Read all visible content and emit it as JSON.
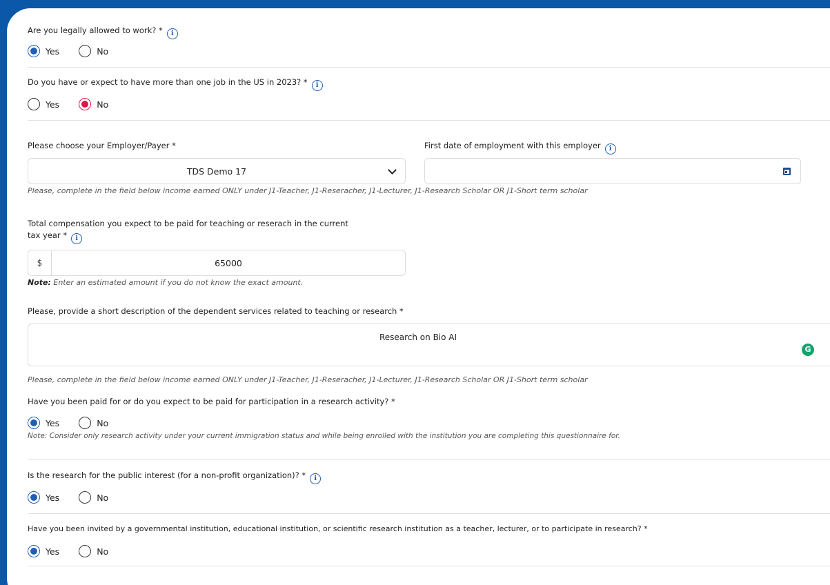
{
  "q1": {
    "label": "Are you legally allowed to work? *",
    "yes": "Yes",
    "no": "No",
    "selected": "Yes"
  },
  "q2": {
    "label": "Do you have or expect to have more than one job in the US in 2023? *",
    "yes": "Yes",
    "no": "No",
    "selected": "No"
  },
  "employer": {
    "label": "Please choose your Employer/Payer *",
    "value": "TDS Demo 17"
  },
  "first_date": {
    "label": "First date of employment with this employer",
    "value": ""
  },
  "hint_income": "Please, complete in the field below income earned ONLY under J1-Teacher, J1-Reseracher, J1-Lecturer, J1-Research Scholar OR J1-Short term scholar",
  "compensation": {
    "label_line1": "Total compensation you expect to be paid for teaching or reserach in the current",
    "label_line2": "tax year *",
    "currency": "$",
    "value": "65000",
    "note_bold": "Note:",
    "note_text": " Enter an estimated amount if you do not know the exact amount."
  },
  "description": {
    "label": "Please, provide a short description of the dependent services related to teaching or research *",
    "value": "Research on Bio AI",
    "grammarly": "G"
  },
  "hint_income_2": "Please, complete in the field below income earned ONLY under J1-Teacher, J1-Reseracher, J1-Lecturer, J1-Research Scholar OR J1-Short term scholar",
  "q3": {
    "label": "Have you been paid for or do you expect to be paid for participation in a research activity? *",
    "yes": "Yes",
    "no": "No",
    "selected": "Yes",
    "note": "Note: Consider only research activity under your current immigration status and while being enrolled with the institution you are completing this questionnaire for."
  },
  "q4": {
    "label": "Is the research for the public interest (for a non-profit organization)? *",
    "yes": "Yes",
    "no": "No",
    "selected": "Yes"
  },
  "q5": {
    "label": "Have you been invited by a governmental institution, educational institution, or scientific research institution as a teacher, lecturer, or to participate in research? *",
    "yes": "Yes",
    "no": "No",
    "selected": "Yes"
  },
  "info_icon_glyph": "i",
  "colors": {
    "background": "#0b57a8",
    "accent": "#1f5fb5",
    "selected_red": "#e0164b"
  }
}
